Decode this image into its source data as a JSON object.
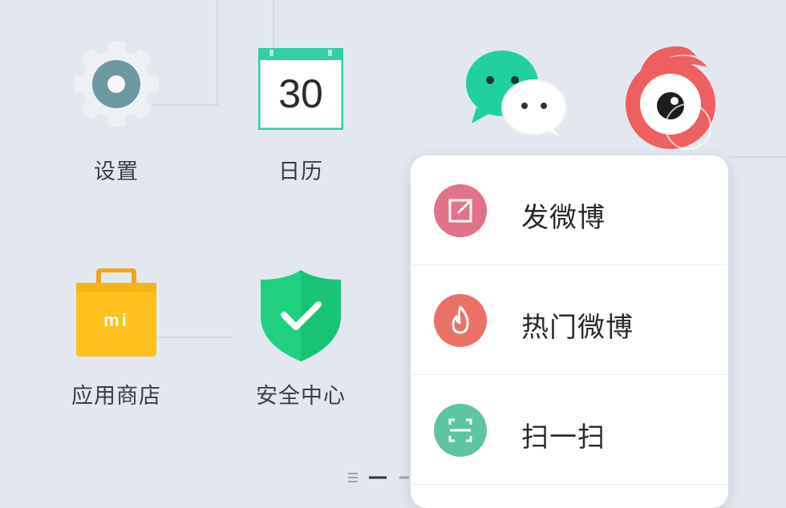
{
  "apps": [
    {
      "label": "设置",
      "icon": "settings-gear-icon"
    },
    {
      "label": "日历",
      "icon": "calendar-icon",
      "day": "30"
    },
    {
      "label": "",
      "icon": "wechat-icon"
    },
    {
      "label": "",
      "icon": "weibo-icon"
    },
    {
      "label": "应用商店",
      "icon": "mi-app-store-icon",
      "badge": "mi"
    },
    {
      "label": "安全中心",
      "icon": "security-shield-icon"
    }
  ],
  "context_menu": {
    "items": [
      {
        "label": "发微博",
        "icon": "compose-icon",
        "color": "#e4718a"
      },
      {
        "label": "热门微博",
        "icon": "flame-icon",
        "color": "#eb7166"
      },
      {
        "label": "扫一扫",
        "icon": "scan-icon",
        "color": "#5dc4a4"
      }
    ]
  },
  "colors": {
    "background": "#e3e8f0",
    "calendar_teal": "#2fcfa8",
    "wechat_green": "#21d0a0",
    "weibo_red": "#ef5f5f",
    "store_yellow": "#ffc21d",
    "shield_green": "#1dd17f"
  }
}
